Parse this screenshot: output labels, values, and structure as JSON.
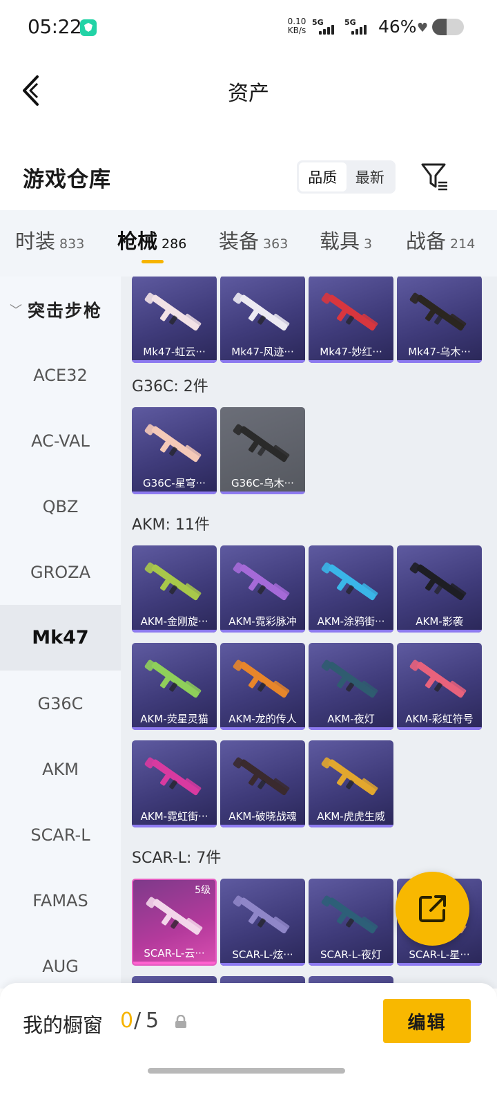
{
  "status_bar": {
    "time": "05:22",
    "net_speed_value": "0.10",
    "net_speed_unit": "KB/s",
    "sim1_label": "5G",
    "sim2_label": "5G",
    "battery_percent": "46%"
  },
  "header": {
    "back_icon": "chevron-left-icon",
    "title": "资产"
  },
  "warehouse": {
    "title": "游戏仓库",
    "sort_options": [
      "品质",
      "最新"
    ],
    "sort_selected": "品质",
    "filter_icon": "filter-icon"
  },
  "tabs": [
    {
      "label": "时装",
      "count": "833"
    },
    {
      "label": "枪械",
      "count": "286",
      "active": true
    },
    {
      "label": "装备",
      "count": "363"
    },
    {
      "label": "载具",
      "count": "3"
    },
    {
      "label": "战备",
      "count": "214"
    }
  ],
  "sidebar": {
    "group_label": "突击步枪",
    "items": [
      "ACE32",
      "AC-VAL",
      "QBZ",
      "GROZA",
      "Mk47",
      "G36C",
      "AKM",
      "SCAR-L",
      "FAMAS",
      "AUG"
    ],
    "active_item": "Mk47"
  },
  "content": {
    "mk47_cards": [
      "Mk47-虹云···",
      "Mk47-风迹···",
      "Mk47-妙红···",
      "Mk47-乌木···"
    ],
    "g36c_title": "G36C: 2件",
    "g36c_cards": [
      "G36C-星穹···",
      "G36C-乌木···"
    ],
    "akm_title": "AKM: 11件",
    "akm_cards": [
      "AKM-金刚旋···",
      "AKM-霓彩脉冲",
      "AKM-涂鸦街···",
      "AKM-影袭",
      "AKM-荧星灵猫",
      "AKM-龙的传人",
      "AKM-夜灯",
      "AKM-彩虹符号",
      "AKM-霓虹街···",
      "AKM-破晓战魂",
      "AKM-虎虎生威"
    ],
    "scarl_title": "SCAR-L: 7件",
    "scarl_cards": [
      "SCAR-L-云···",
      "SCAR-L-炫···",
      "SCAR-L-夜灯",
      "SCAR-L-星···"
    ],
    "scarl_first_level": "5级"
  },
  "colors": {
    "accent": "#f8b800",
    "card_purple": "#3f3b7a",
    "card_pink": "#d94fb0",
    "card_gray": "#5e6168"
  },
  "bottom_bar": {
    "showcase_label": "我的橱窗",
    "showcase_used": "0",
    "showcase_separator": "/",
    "showcase_total": "5",
    "edit_label": "编辑"
  }
}
